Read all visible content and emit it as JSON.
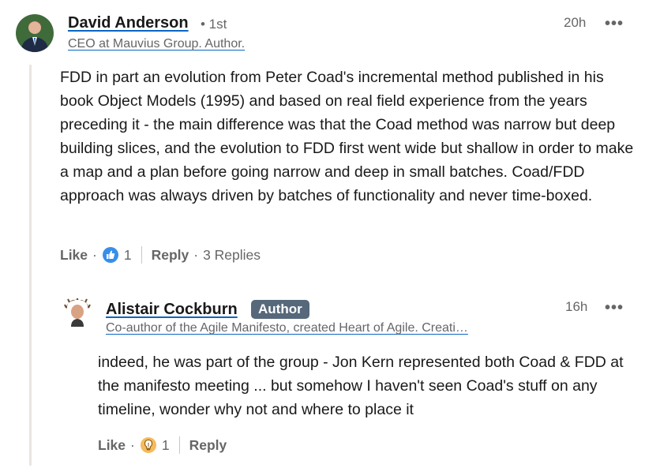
{
  "comment": {
    "author_name": "David Anderson",
    "degree": "• 1st",
    "headline": "CEO at Mauvius Group. Author.",
    "time": "20h",
    "more": "•••",
    "text": "FDD in part an evolution from Peter Coad's incremental method published in his book Object Models (1995) and based on real field experience from the years preceding it - the main difference was that the Coad method was narrow but deep building slices, and the evolution to FDD first went wide but shallow in order to make a map and a plan before going narrow and deep in small batches. Coad/FDD approach was always driven by batches of functionality and never time-boxed.",
    "like_label": "Like",
    "dot": "·",
    "reaction_icon": "thumbs-up-icon",
    "reaction_count": "1",
    "reply_label": "Reply",
    "replies_label": "3 Replies"
  },
  "reply": {
    "author_name": "Alistair Cockburn",
    "badge": "Author",
    "headline": "Co-author of the Agile Manifesto, created Heart of Agile. Creati…",
    "time": "16h",
    "more": "•••",
    "text": "indeed, he was part of the group - Jon Kern represented both Coad & FDD at the manifesto meeting ... but somehow I haven't seen Coad's stuff on any timeline, wonder why not and where to place it",
    "like_label": "Like",
    "dot": "·",
    "reaction_icon": "lightbulb-icon",
    "reaction_count": "1",
    "reply_label": "Reply"
  },
  "colors": {
    "link_underline": "#0a66c2",
    "badge_bg": "#56687a",
    "like_blue": "#378fe9",
    "insightful_yellow": "#f5bb5c",
    "thread_line": "#e8e6df"
  }
}
